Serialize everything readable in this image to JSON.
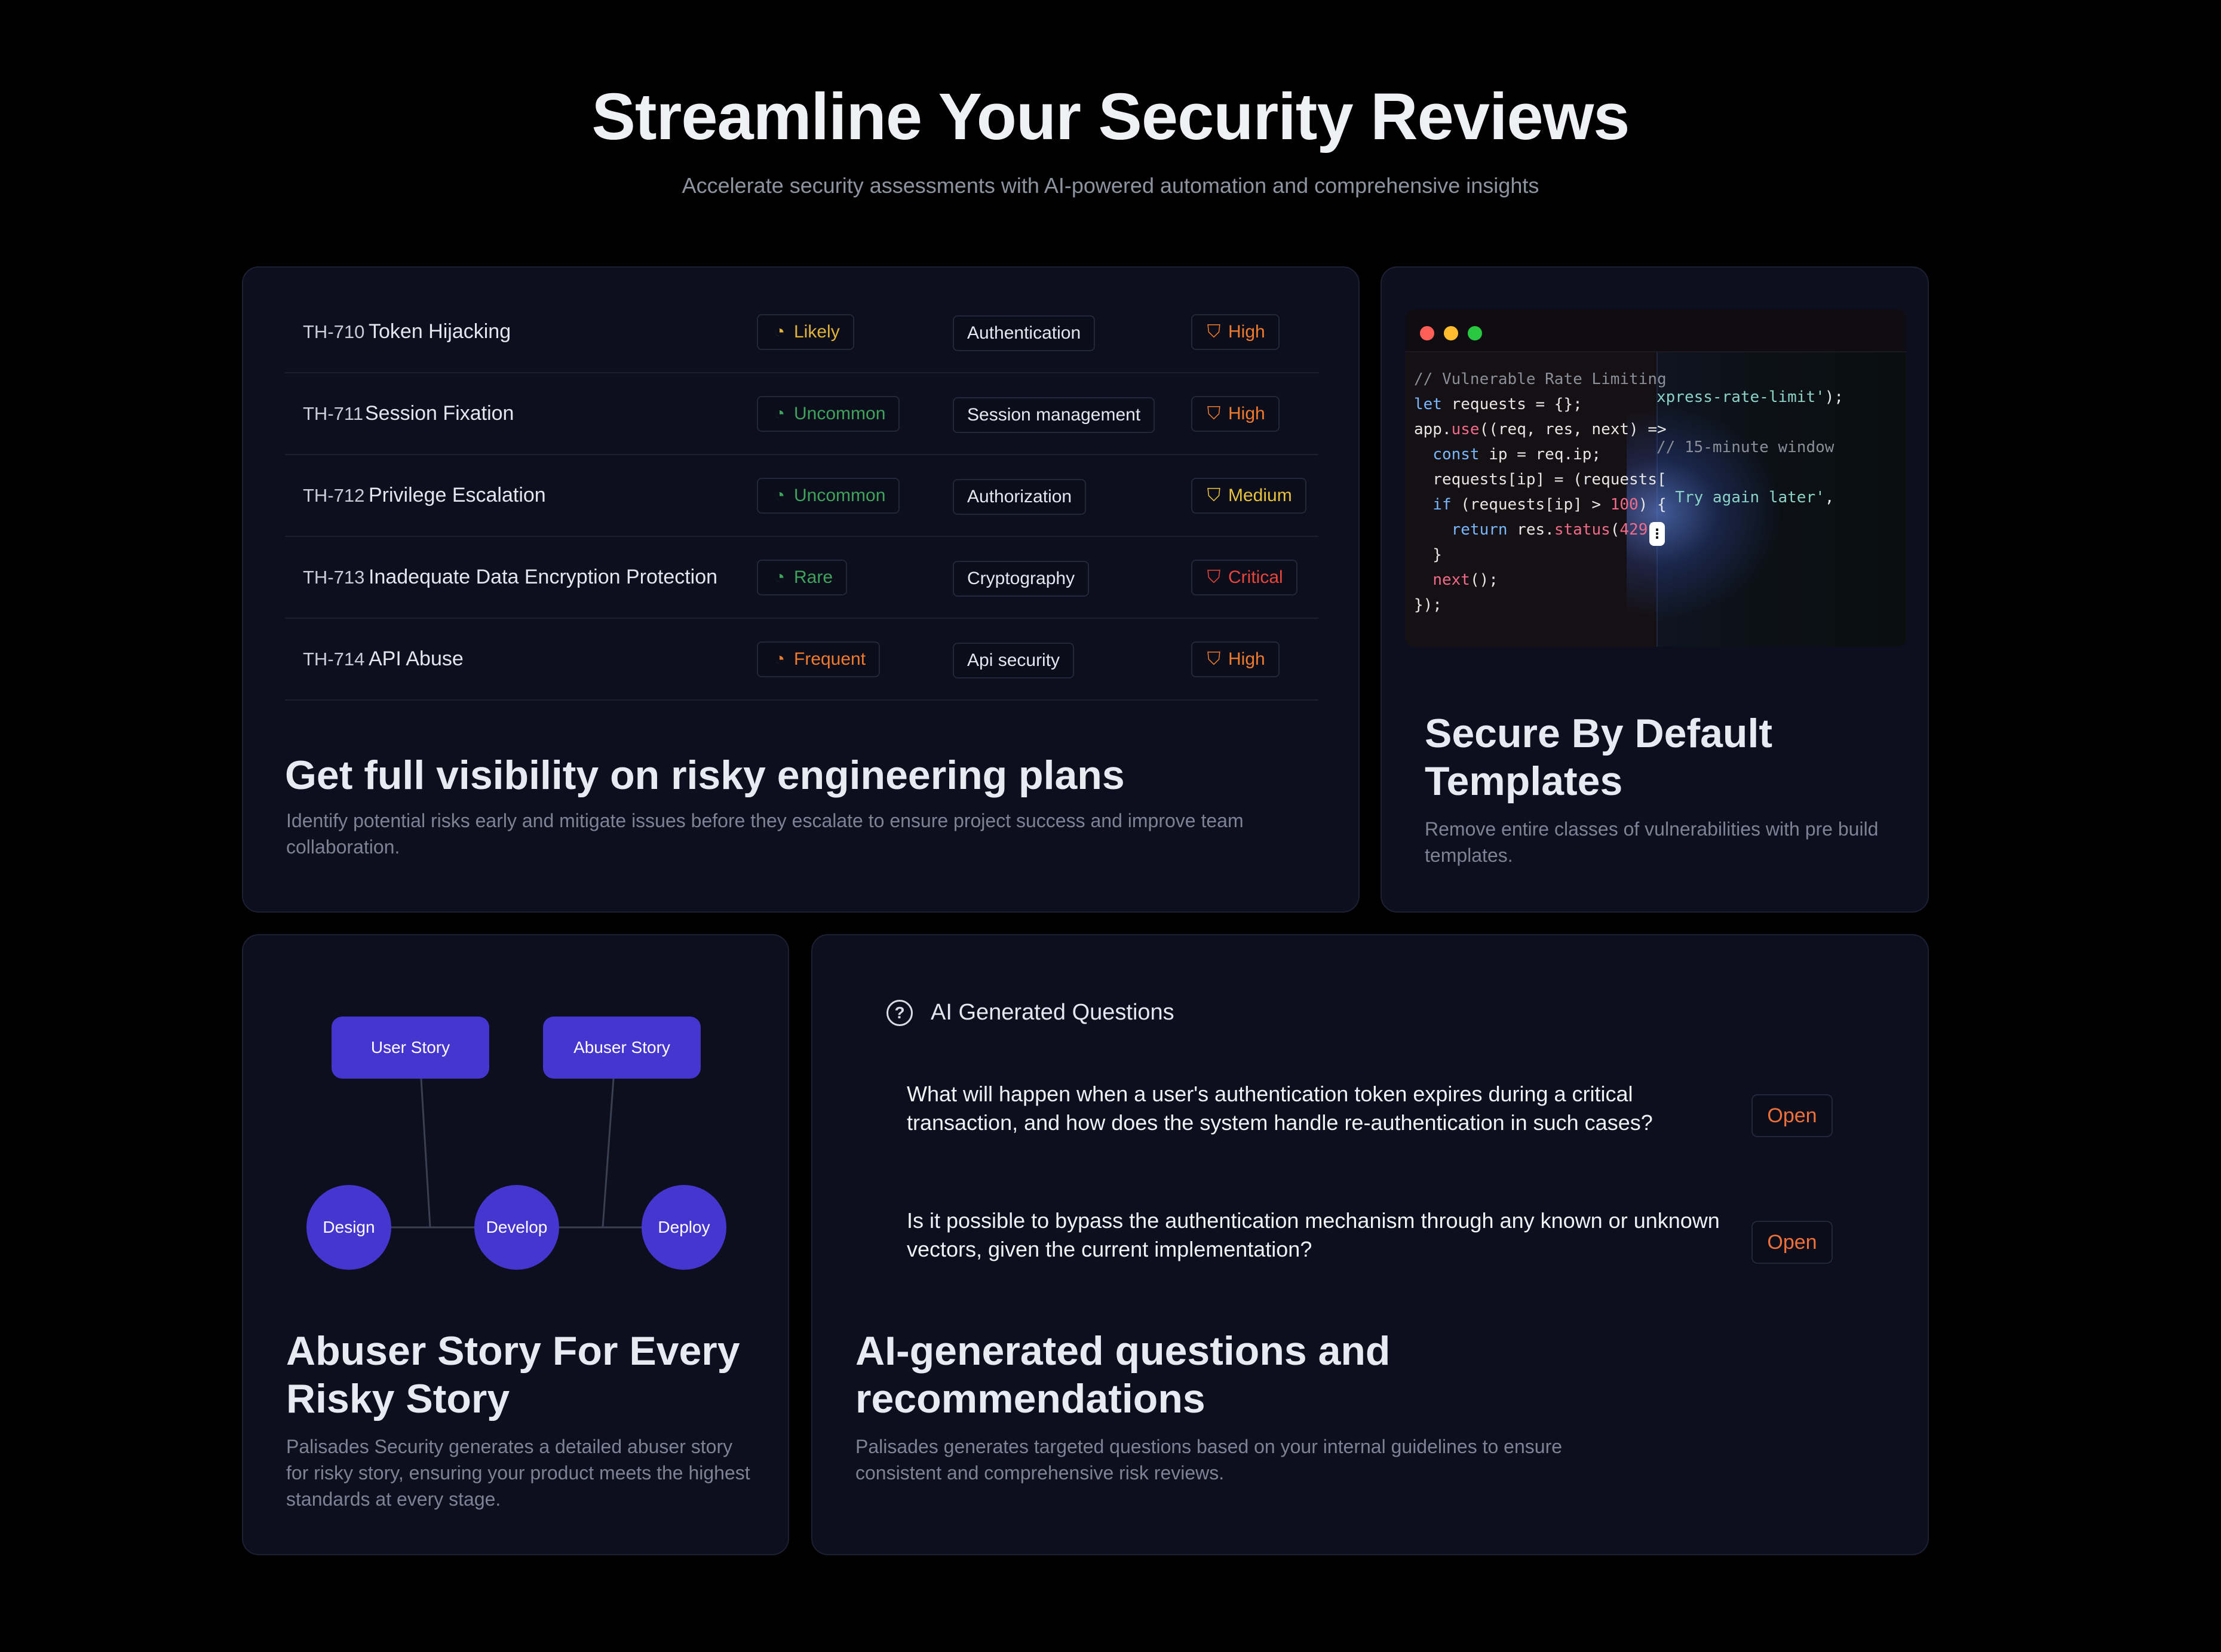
{
  "hero": {
    "title": "Streamline Your Security Reviews",
    "subtitle": "Accelerate security assessments with AI-powered automation and comprehensive insights"
  },
  "threats_card": {
    "rows": [
      {
        "id": "TH-710",
        "name": "Token Hijacking",
        "likelihood": "Likely",
        "category": "Authentication",
        "severity": "High"
      },
      {
        "id": "TH-711",
        "name": "Session Fixation",
        "likelihood": "Uncommon",
        "category": "Session management",
        "severity": "High"
      },
      {
        "id": "TH-712",
        "name": "Privilege Escalation",
        "likelihood": "Uncommon",
        "category": "Authorization",
        "severity": "Medium"
      },
      {
        "id": "TH-713",
        "name": "Inadequate Data Encryption Protection",
        "likelihood": "Rare",
        "category": "Cryptography",
        "severity": "Critical"
      },
      {
        "id": "TH-714",
        "name": "API Abuse",
        "likelihood": "Frequent",
        "category": "Api security",
        "severity": "High"
      }
    ],
    "title": "Get full visibility on risky engineering plans",
    "description": "Identify potential risks early and mitigate issues before they escalate to ensure project success and improve team collaboration."
  },
  "likelihood_colors": {
    "Likely": "#e0b43a",
    "Uncommon": "#3fa35c",
    "Rare": "#3fa35c",
    "Frequent": "#ef7b2f"
  },
  "severity_colors": {
    "High": "#ef7b2f",
    "Medium": "#e8c23d",
    "Critical": "#e8453c"
  },
  "icons": {
    "likelihood": "gauge-icon",
    "severity": "shield-icon",
    "question": "question-circle-icon",
    "handle": "drag-handle-icon"
  },
  "code_card": {
    "window_dots": [
      "#ff5f57",
      "#febc2e",
      "#28c840"
    ],
    "code_left": [
      [
        {
          "t": "// Vulnerable Rate Limiting",
          "c": "c-comment"
        }
      ],
      [
        {
          "t": "let",
          "c": "c-kw"
        },
        {
          "t": " requests = {};",
          "c": ""
        }
      ],
      [
        {
          "t": "app.",
          "c": ""
        },
        {
          "t": "use",
          "c": "c-fn"
        },
        {
          "t": "((req, res, next) =>",
          "c": ""
        }
      ],
      [
        {
          "t": "  ",
          "c": ""
        },
        {
          "t": "const",
          "c": "c-kw"
        },
        {
          "t": " ip = req.ip;",
          "c": ""
        }
      ],
      [
        {
          "t": "  requests[ip] = (requests[",
          "c": ""
        }
      ],
      [
        {
          "t": "  ",
          "c": ""
        },
        {
          "t": "if",
          "c": "c-kw"
        },
        {
          "t": " (requests[ip] > ",
          "c": ""
        },
        {
          "t": "100",
          "c": "c-num"
        },
        {
          "t": ") {",
          "c": ""
        }
      ],
      [
        {
          "t": "    ",
          "c": ""
        },
        {
          "t": "return",
          "c": "c-kw"
        },
        {
          "t": " res.",
          "c": ""
        },
        {
          "t": "status",
          "c": "c-fn"
        },
        {
          "t": "(",
          "c": ""
        },
        {
          "t": "429",
          "c": "c-num"
        },
        {
          "t": ").",
          "c": ""
        }
      ],
      [
        {
          "t": "  }",
          "c": ""
        }
      ],
      [
        {
          "t": "  ",
          "c": ""
        },
        {
          "t": "next",
          "c": "c-fn"
        },
        {
          "t": "();",
          "c": ""
        }
      ],
      [
        {
          "t": "});",
          "c": ""
        }
      ]
    ],
    "code_right": [
      [
        {
          "t": "xpress-rate-limit'",
          "c": "c-str"
        },
        {
          "t": ");",
          "c": ""
        }
      ],
      [
        {
          "t": "",
          "c": ""
        }
      ],
      [
        {
          "t": "// 15-minute window",
          "c": "c-comment"
        }
      ],
      [
        {
          "t": "",
          "c": ""
        }
      ],
      [
        {
          "t": "  Try again later'",
          "c": "c-str"
        },
        {
          "t": ",",
          "c": ""
        }
      ]
    ],
    "title": "Secure By Default Templates",
    "description": "Remove entire classes of vulnerabilities with pre build templates."
  },
  "abuser_card": {
    "stories": [
      "User Story",
      "Abuser Story"
    ],
    "stages": [
      "Design",
      "Develop",
      "Deploy"
    ],
    "title": "Abuser Story For Every Risky Story",
    "description": "Palisades Security generates a detailed abuser story for risky story, ensuring your product meets the highest standards at every stage."
  },
  "questions_card": {
    "header": "AI Generated Questions",
    "questions": [
      {
        "text": "What will happen when a user's authentication token expires during a critical transaction, and how does the system handle re-authentication in such cases?",
        "action": "Open"
      },
      {
        "text": "Is it possible to bypass the authentication mechanism through any known or unknown vectors, given the current implementation?",
        "action": "Open"
      }
    ],
    "title": "AI-generated questions and recommendations",
    "description": "Palisades generates targeted questions based on your internal guidelines to ensure consistent and comprehensive risk reviews."
  }
}
